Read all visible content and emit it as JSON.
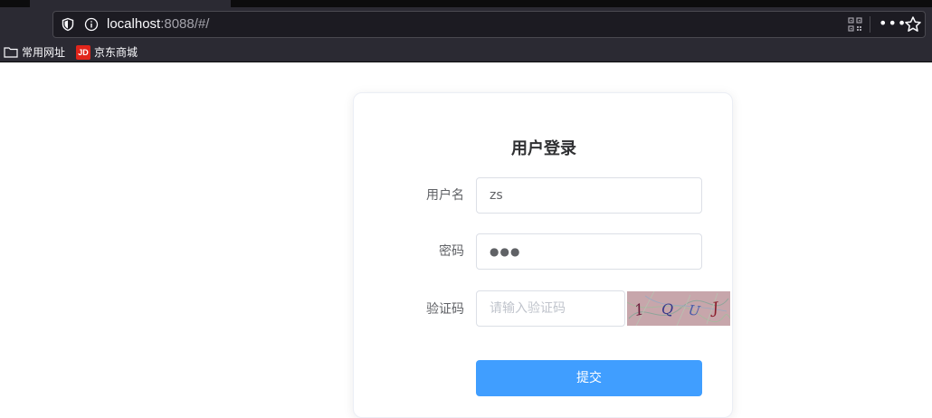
{
  "browser": {
    "url_host": "localhost",
    "url_rest": ":8088/#/",
    "more_label": "•••",
    "bookmarks": [
      {
        "label": "常用网址",
        "icon": "folder-icon"
      },
      {
        "label": "京东商城",
        "icon": "jd-icon",
        "icon_text": "JD"
      }
    ]
  },
  "login": {
    "title": "用户登录",
    "username_label": "用户名",
    "username_value": "zs",
    "password_label": "密码",
    "password_masked": "●●●",
    "captcha_label": "验证码",
    "captcha_placeholder": "请输入验证码",
    "captcha_text": "1QUJ",
    "submit_label": "提交"
  },
  "colors": {
    "primary": "#409eff",
    "title": "#303133",
    "label": "#606266",
    "border": "#dcdfe6"
  }
}
